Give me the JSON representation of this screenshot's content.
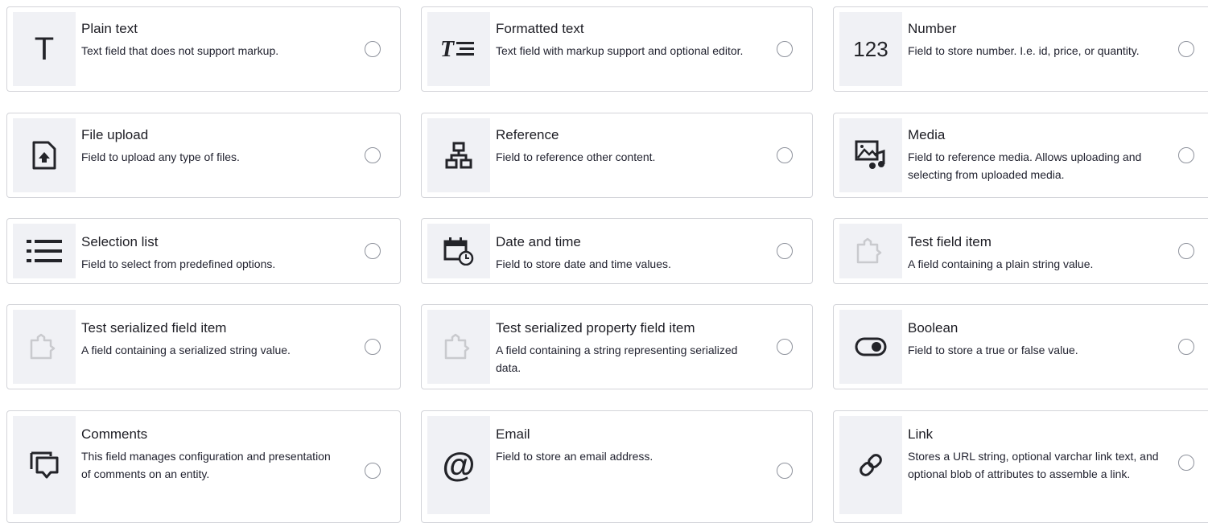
{
  "field_types": [
    {
      "icon": "plain-text-icon",
      "title": "Plain text",
      "description": "Text field that does not support markup."
    },
    {
      "icon": "formatted-text-icon",
      "title": "Formatted text",
      "description": "Text field with markup support and optional editor."
    },
    {
      "icon": "number-icon",
      "title": "Number",
      "description": "Field to store number. I.e. id, price, or quantity."
    },
    {
      "icon": "file-upload-icon",
      "title": "File upload",
      "description": "Field to upload any type of files."
    },
    {
      "icon": "reference-icon",
      "title": "Reference",
      "description": "Field to reference other content."
    },
    {
      "icon": "media-icon",
      "title": "Media",
      "description": "Field to reference media. Allows uploading and selecting from uploaded media."
    },
    {
      "icon": "selection-list-icon",
      "title": "Selection list",
      "description": "Field to select from predefined options."
    },
    {
      "icon": "date-time-icon",
      "title": "Date and time",
      "description": "Field to store date and time values."
    },
    {
      "icon": "puzzle-icon",
      "title": "Test field item",
      "description": "A field containing a plain string value."
    },
    {
      "icon": "puzzle-icon",
      "title": "Test serialized field item",
      "description": "A field containing a serialized string value."
    },
    {
      "icon": "puzzle-icon",
      "title": "Test serialized property field item",
      "description": "A field containing a string representing serialized data."
    },
    {
      "icon": "boolean-toggle-icon",
      "title": "Boolean",
      "description": "Field to store a true or false value."
    },
    {
      "icon": "comments-icon",
      "title": "Comments",
      "description": "This field manages configuration and presentation of comments on an entity."
    },
    {
      "icon": "email-at-icon",
      "title": "Email",
      "description": "Field to store an email address."
    },
    {
      "icon": "link-icon",
      "title": "Link",
      "description": "Stores a URL string, optional varchar link text, and optional blob of attributes to assemble a link."
    }
  ],
  "text_icons": {
    "plain_text": "T",
    "number": "123",
    "email": "@"
  }
}
